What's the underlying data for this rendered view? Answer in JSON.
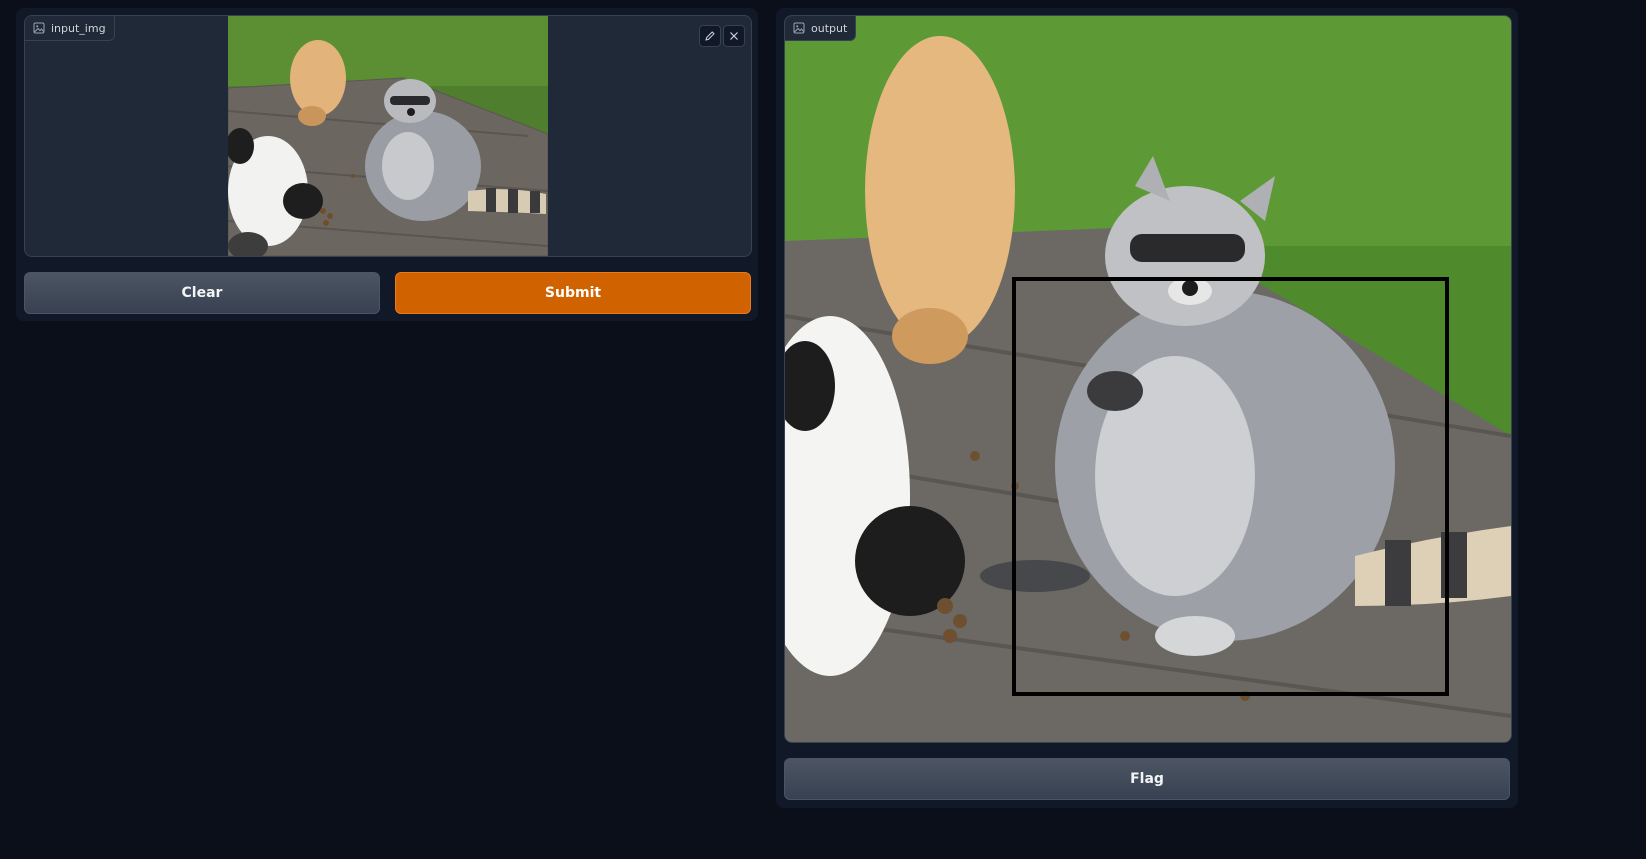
{
  "input": {
    "label": "input_img",
    "label_icon": "image-icon",
    "edit_icon": "pencil-icon",
    "close_icon": "close-icon"
  },
  "output": {
    "label": "output",
    "label_icon": "image-icon"
  },
  "buttons": {
    "clear": "Clear",
    "submit": "Submit",
    "flag": "Flag"
  },
  "colors": {
    "background": "#0b0f19",
    "panel": "#111827",
    "submit_accent": "#d16200",
    "secondary_button": "#4b5563"
  }
}
